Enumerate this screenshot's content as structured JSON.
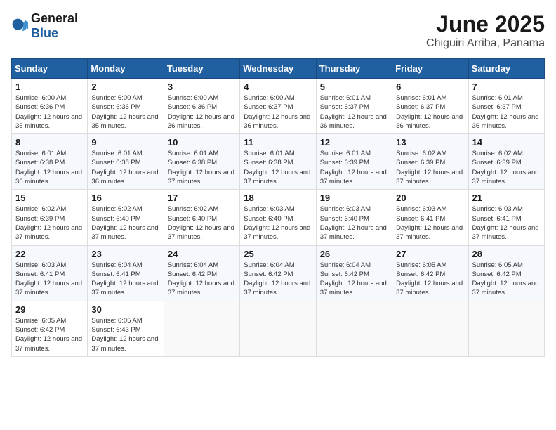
{
  "header": {
    "logo_general": "General",
    "logo_blue": "Blue",
    "title": "June 2025",
    "subtitle": "Chiguiri Arriba, Panama"
  },
  "columns": [
    "Sunday",
    "Monday",
    "Tuesday",
    "Wednesday",
    "Thursday",
    "Friday",
    "Saturday"
  ],
  "weeks": [
    [
      {
        "day": "1",
        "sunrise": "Sunrise: 6:00 AM",
        "sunset": "Sunset: 6:36 PM",
        "daylight": "Daylight: 12 hours and 35 minutes."
      },
      {
        "day": "2",
        "sunrise": "Sunrise: 6:00 AM",
        "sunset": "Sunset: 6:36 PM",
        "daylight": "Daylight: 12 hours and 35 minutes."
      },
      {
        "day": "3",
        "sunrise": "Sunrise: 6:00 AM",
        "sunset": "Sunset: 6:36 PM",
        "daylight": "Daylight: 12 hours and 36 minutes."
      },
      {
        "day": "4",
        "sunrise": "Sunrise: 6:00 AM",
        "sunset": "Sunset: 6:37 PM",
        "daylight": "Daylight: 12 hours and 36 minutes."
      },
      {
        "day": "5",
        "sunrise": "Sunrise: 6:01 AM",
        "sunset": "Sunset: 6:37 PM",
        "daylight": "Daylight: 12 hours and 36 minutes."
      },
      {
        "day": "6",
        "sunrise": "Sunrise: 6:01 AM",
        "sunset": "Sunset: 6:37 PM",
        "daylight": "Daylight: 12 hours and 36 minutes."
      },
      {
        "day": "7",
        "sunrise": "Sunrise: 6:01 AM",
        "sunset": "Sunset: 6:37 PM",
        "daylight": "Daylight: 12 hours and 36 minutes."
      }
    ],
    [
      {
        "day": "8",
        "sunrise": "Sunrise: 6:01 AM",
        "sunset": "Sunset: 6:38 PM",
        "daylight": "Daylight: 12 hours and 36 minutes."
      },
      {
        "day": "9",
        "sunrise": "Sunrise: 6:01 AM",
        "sunset": "Sunset: 6:38 PM",
        "daylight": "Daylight: 12 hours and 36 minutes."
      },
      {
        "day": "10",
        "sunrise": "Sunrise: 6:01 AM",
        "sunset": "Sunset: 6:38 PM",
        "daylight": "Daylight: 12 hours and 37 minutes."
      },
      {
        "day": "11",
        "sunrise": "Sunrise: 6:01 AM",
        "sunset": "Sunset: 6:38 PM",
        "daylight": "Daylight: 12 hours and 37 minutes."
      },
      {
        "day": "12",
        "sunrise": "Sunrise: 6:01 AM",
        "sunset": "Sunset: 6:39 PM",
        "daylight": "Daylight: 12 hours and 37 minutes."
      },
      {
        "day": "13",
        "sunrise": "Sunrise: 6:02 AM",
        "sunset": "Sunset: 6:39 PM",
        "daylight": "Daylight: 12 hours and 37 minutes."
      },
      {
        "day": "14",
        "sunrise": "Sunrise: 6:02 AM",
        "sunset": "Sunset: 6:39 PM",
        "daylight": "Daylight: 12 hours and 37 minutes."
      }
    ],
    [
      {
        "day": "15",
        "sunrise": "Sunrise: 6:02 AM",
        "sunset": "Sunset: 6:39 PM",
        "daylight": "Daylight: 12 hours and 37 minutes."
      },
      {
        "day": "16",
        "sunrise": "Sunrise: 6:02 AM",
        "sunset": "Sunset: 6:40 PM",
        "daylight": "Daylight: 12 hours and 37 minutes."
      },
      {
        "day": "17",
        "sunrise": "Sunrise: 6:02 AM",
        "sunset": "Sunset: 6:40 PM",
        "daylight": "Daylight: 12 hours and 37 minutes."
      },
      {
        "day": "18",
        "sunrise": "Sunrise: 6:03 AM",
        "sunset": "Sunset: 6:40 PM",
        "daylight": "Daylight: 12 hours and 37 minutes."
      },
      {
        "day": "19",
        "sunrise": "Sunrise: 6:03 AM",
        "sunset": "Sunset: 6:40 PM",
        "daylight": "Daylight: 12 hours and 37 minutes."
      },
      {
        "day": "20",
        "sunrise": "Sunrise: 6:03 AM",
        "sunset": "Sunset: 6:41 PM",
        "daylight": "Daylight: 12 hours and 37 minutes."
      },
      {
        "day": "21",
        "sunrise": "Sunrise: 6:03 AM",
        "sunset": "Sunset: 6:41 PM",
        "daylight": "Daylight: 12 hours and 37 minutes."
      }
    ],
    [
      {
        "day": "22",
        "sunrise": "Sunrise: 6:03 AM",
        "sunset": "Sunset: 6:41 PM",
        "daylight": "Daylight: 12 hours and 37 minutes."
      },
      {
        "day": "23",
        "sunrise": "Sunrise: 6:04 AM",
        "sunset": "Sunset: 6:41 PM",
        "daylight": "Daylight: 12 hours and 37 minutes."
      },
      {
        "day": "24",
        "sunrise": "Sunrise: 6:04 AM",
        "sunset": "Sunset: 6:42 PM",
        "daylight": "Daylight: 12 hours and 37 minutes."
      },
      {
        "day": "25",
        "sunrise": "Sunrise: 6:04 AM",
        "sunset": "Sunset: 6:42 PM",
        "daylight": "Daylight: 12 hours and 37 minutes."
      },
      {
        "day": "26",
        "sunrise": "Sunrise: 6:04 AM",
        "sunset": "Sunset: 6:42 PM",
        "daylight": "Daylight: 12 hours and 37 minutes."
      },
      {
        "day": "27",
        "sunrise": "Sunrise: 6:05 AM",
        "sunset": "Sunset: 6:42 PM",
        "daylight": "Daylight: 12 hours and 37 minutes."
      },
      {
        "day": "28",
        "sunrise": "Sunrise: 6:05 AM",
        "sunset": "Sunset: 6:42 PM",
        "daylight": "Daylight: 12 hours and 37 minutes."
      }
    ],
    [
      {
        "day": "29",
        "sunrise": "Sunrise: 6:05 AM",
        "sunset": "Sunset: 6:42 PM",
        "daylight": "Daylight: 12 hours and 37 minutes."
      },
      {
        "day": "30",
        "sunrise": "Sunrise: 6:05 AM",
        "sunset": "Sunset: 6:43 PM",
        "daylight": "Daylight: 12 hours and 37 minutes."
      },
      null,
      null,
      null,
      null,
      null
    ]
  ]
}
